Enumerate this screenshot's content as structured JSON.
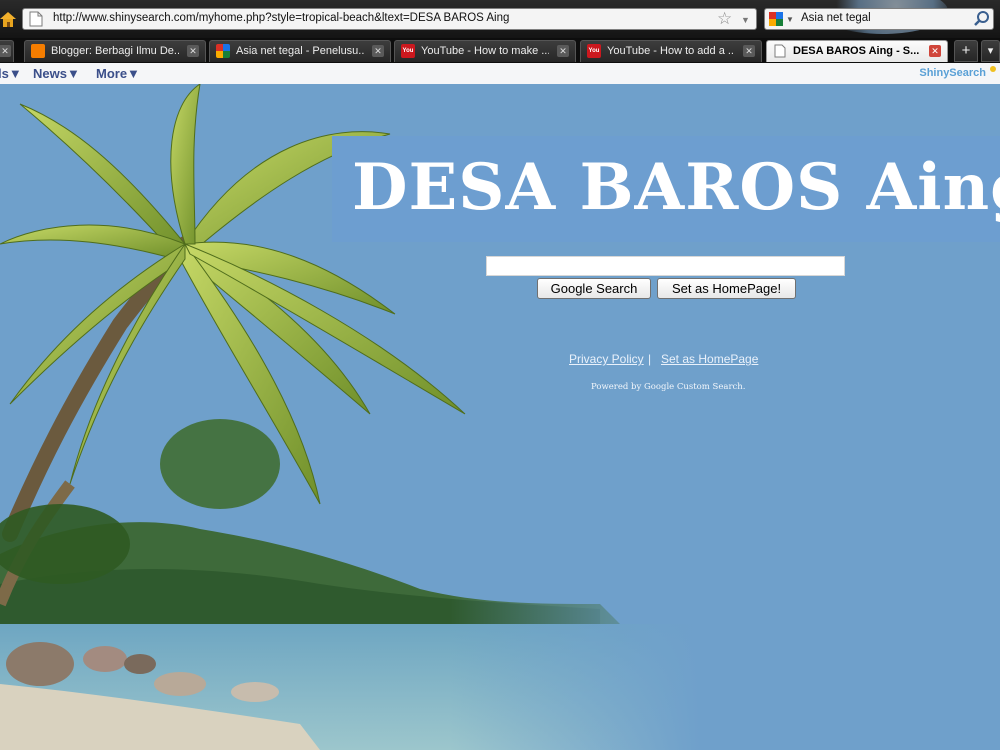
{
  "browser": {
    "url": "http://www.shinysearch.com/myhome.php?style=tropical-beach&ltext=DESA BAROS Aing",
    "search_query": "Asia net tegal",
    "tabs": [
      {
        "title": "Blogger: Berbagi Ilmu De...",
        "icon": "blogger-icon",
        "active": false
      },
      {
        "title": "Asia net tegal - Penelusu...",
        "icon": "google-icon",
        "active": false
      },
      {
        "title": "YouTube - How to make ...",
        "icon": "youtube-icon",
        "active": false
      },
      {
        "title": "YouTube - How to add a ...",
        "icon": "youtube-icon",
        "active": false
      },
      {
        "title": "DESA BAROS Aing - S...",
        "icon": "page-icon",
        "active": true
      }
    ],
    "new_tab_label": "+",
    "tab_list_label": "▾"
  },
  "navbar": {
    "items": [
      "ls▼",
      "News▼",
      "More▼"
    ],
    "brand": "ShinySearch"
  },
  "page": {
    "title": "DESA BAROS Aing",
    "search_value": "",
    "google_search_label": "Google Search",
    "set_homepage_label": "Set as HomePage!",
    "privacy_link": "Privacy Policy",
    "separator": "|",
    "set_homepage_link": "Set as HomePage",
    "powered_by": "Powered by Google Custom Search."
  },
  "colors": {
    "sky": "#6fa0cb",
    "title_bg": "#6d9ed0",
    "nav_text": "#3b4f8a",
    "brand": "#5aa0d6",
    "chrome": "#1a1a1a"
  }
}
